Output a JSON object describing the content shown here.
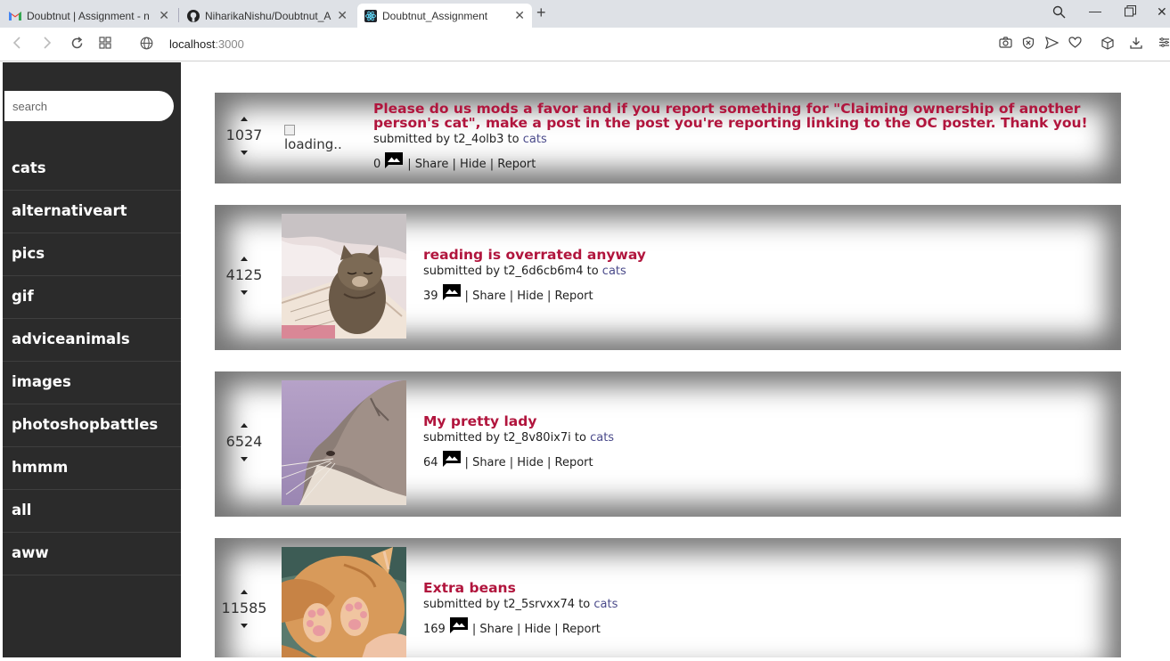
{
  "browser": {
    "tabs": [
      {
        "label": "Doubtnut | Assignment - n",
        "icon": "gmail-icon"
      },
      {
        "label": "NiharikaNishu/Doubtnut_A",
        "icon": "github-icon"
      },
      {
        "label": "Doubtnut_Assignment",
        "icon": "react-icon",
        "active": true
      }
    ],
    "url_host": "localhost",
    "url_port": ":3000"
  },
  "search": {
    "placeholder": "search"
  },
  "sidebar": {
    "items": [
      "cats",
      "alternativeart",
      "pics",
      "gif",
      "adviceanimals",
      "images",
      "photoshopbattles",
      "hmmm",
      "all",
      "aww"
    ]
  },
  "posts": [
    {
      "score": "1037",
      "thumbnail_alt": "loading..",
      "title": "Please do us mods a favor and if you report something for \"Claiming ownership of another person's cat\", make a post in the post you're reporting linking to the OC poster. Thank you!",
      "submitted_by": "submitted by t2_4olb3 to",
      "subreddit": "cats",
      "comments": "0",
      "share": "Share",
      "hide": "Hide",
      "report": "Report"
    },
    {
      "score": "4125",
      "title": "reading is overrated anyway",
      "submitted_by": "submitted by t2_6d6cb6m4 to",
      "subreddit": "cats",
      "comments": "39",
      "share": "Share",
      "hide": "Hide",
      "report": "Report"
    },
    {
      "score": "6524",
      "title": "My pretty lady",
      "submitted_by": "submitted by t2_8v80ix7i to",
      "subreddit": "cats",
      "comments": "64",
      "share": "Share",
      "hide": "Hide",
      "report": "Report"
    },
    {
      "score": "11585",
      "title": "Extra beans",
      "submitted_by": "submitted by t2_5srvxx74 to",
      "subreddit": "cats",
      "comments": "169",
      "share": "Share",
      "hide": "Hide",
      "report": "Report"
    }
  ],
  "colors": {
    "title": "#b1153d",
    "sidebar": "#2b2b2b",
    "link": "#4a4a8a"
  }
}
